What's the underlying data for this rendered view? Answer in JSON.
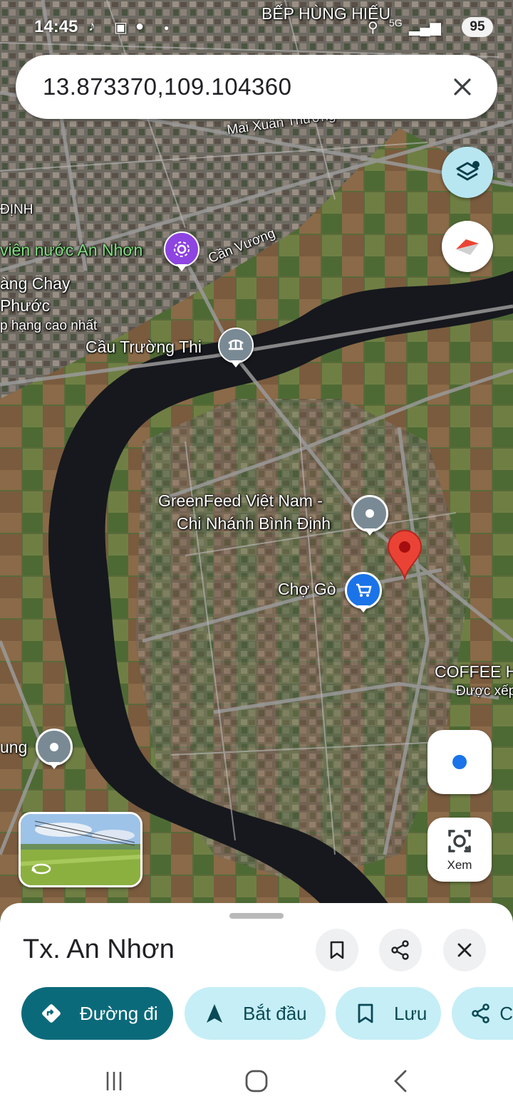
{
  "status_bar": {
    "time": "14:45",
    "battery": "95",
    "network": "5G"
  },
  "search": {
    "value": "13.873370,109.104360"
  },
  "map": {
    "labels": {
      "bep_hung_hieu": "BẾP HÙNG HIẾU",
      "mai_xuan_thuong": "Mai Xuân Thưởng",
      "dinh": "ĐỊNH",
      "vien_nuoc": "viên nước An Nhơn",
      "can_vuong": "Cần Vương",
      "ang_chay": "àng Chay",
      "phuoc": "Phước",
      "xep_hang": "p hạng cao nhất",
      "cau_truong_thi": "Cầu Trường Thi",
      "greenfeed_1": "GreenFeed Việt Nam -",
      "greenfeed_2": "Chi Nhánh Bình Định",
      "cho_go": "Chợ Gò",
      "coffee": "COFFEE H",
      "duoc_xep": "Được xếp",
      "ung": "ung"
    }
  },
  "controls": {
    "lens_label": "Xem"
  },
  "sheet": {
    "title": "Tx. An Nhơn",
    "chips": {
      "directions": "Đường đi",
      "start": "Bắt đầu",
      "save": "Lưu",
      "share": "C"
    }
  },
  "colors": {
    "primary_chip": "#0b6a7a",
    "secondary_chip": "#c6eef6",
    "pin_red": "#ea4335",
    "location_blue": "#1a73e8"
  }
}
